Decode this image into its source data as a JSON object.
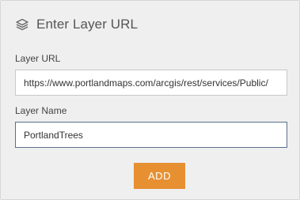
{
  "header": {
    "title": "Enter Layer URL",
    "icon": "layers-icon"
  },
  "layer_url": {
    "label": "Layer URL",
    "value": "https://www.portlandmaps.com/arcgis/rest/services/Public/"
  },
  "layer_name": {
    "label": "Layer Name",
    "value": "PortlandTrees"
  },
  "add_button": {
    "label": "ADD",
    "color": "#e69032"
  }
}
